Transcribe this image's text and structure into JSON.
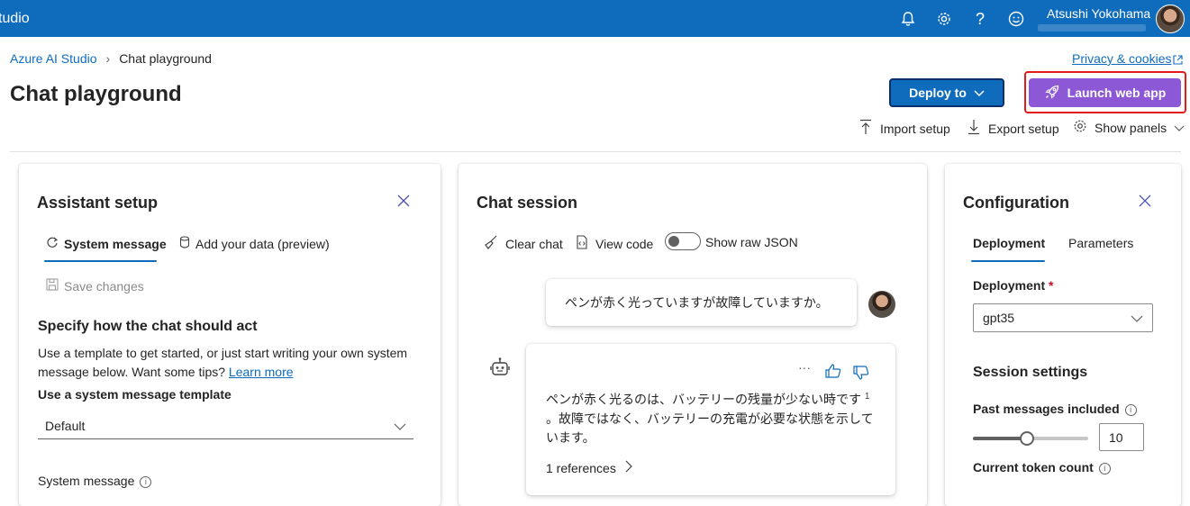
{
  "topbar": {
    "app_title": "tudio",
    "user_name": "Atsushi Yokohama",
    "icons": [
      "bell-icon",
      "gear-icon",
      "help-icon",
      "smiley-icon"
    ]
  },
  "breadcrumb": {
    "root": "Azure AI Studio",
    "current": "Chat playground"
  },
  "privacy_link": "Privacy & cookies",
  "page_title": "Chat playground",
  "actions": {
    "deploy": "Deploy to",
    "launch": "Launch web app"
  },
  "toolbar": {
    "import": "Import setup",
    "export": "Export setup",
    "panels": "Show panels"
  },
  "assistant": {
    "title": "Assistant setup",
    "tab_system": "System message",
    "tab_data": "Add your data (preview)",
    "save": "Save changes",
    "heading": "Specify how the chat should act",
    "desc": "Use a template to get started, or just start writing your own system message below. Want some tips?",
    "learn_more": "Learn more",
    "template_label": "Use a system message template",
    "template_value": "Default",
    "system_message_label": "System message"
  },
  "chat": {
    "title": "Chat session",
    "clear": "Clear chat",
    "view_code": "View code",
    "raw_json": "Show raw JSON",
    "user_message": "ペンが赤く光っていますが故障していますか。",
    "assistant_message_1": "ペンが赤く光るのは、バッテリーの残量が少ない時です",
    "citation": "1",
    "assistant_message_2": "。故障ではなく、バッテリーの充電が必要な状態を示しています。",
    "references": "1 references",
    "more": "···"
  },
  "config": {
    "title": "Configuration",
    "tab_deployment": "Deployment",
    "tab_parameters": "Parameters",
    "deployment_label": "Deployment",
    "required_mark": "*",
    "deployment_value": "gpt35",
    "session_settings": "Session settings",
    "past_messages_label": "Past messages included",
    "past_messages_value": "10",
    "past_messages_slider_fraction": 0.47,
    "token_count_label": "Current token count"
  },
  "colors": {
    "brand": "#0f6cbd",
    "launch": "#8d58d6",
    "highlight": "#e31b1b"
  }
}
